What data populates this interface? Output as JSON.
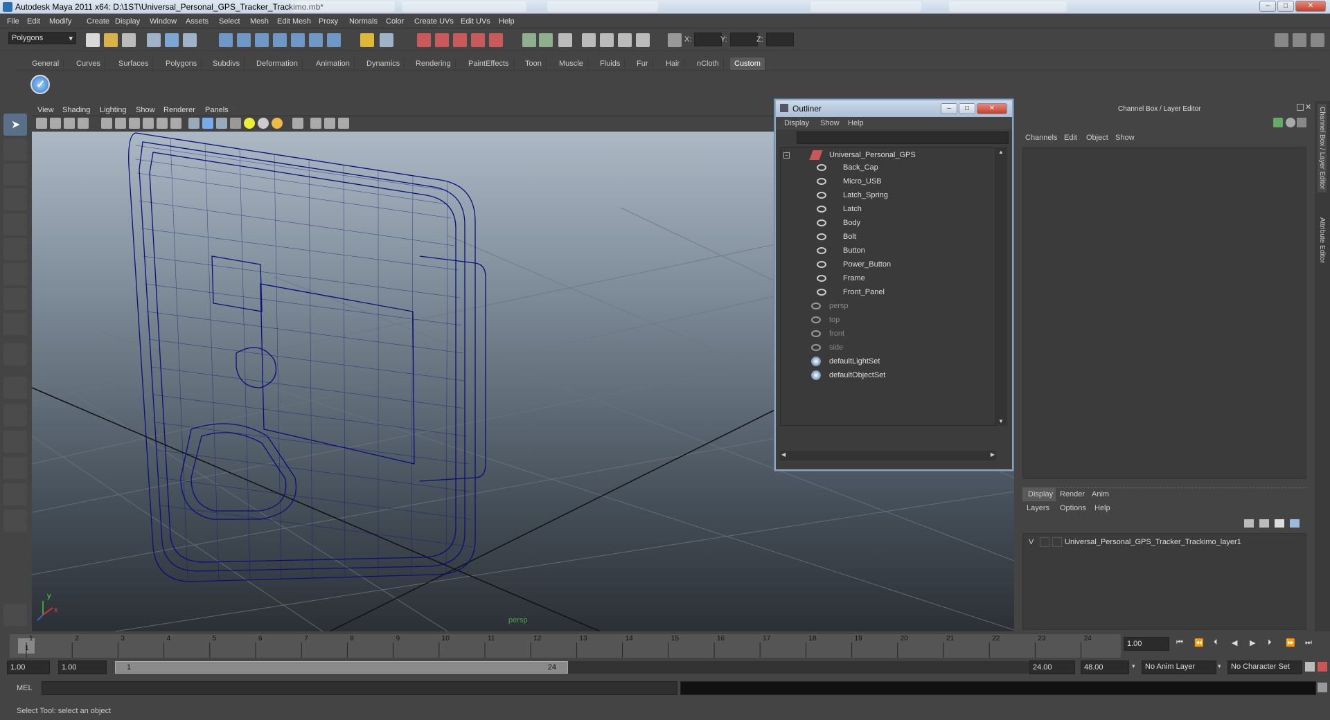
{
  "window": {
    "title": "Autodesk Maya 2011 x64: D:\\1ST\\Universal_Personal_GPS_Tracker_Trackimo.mb*"
  },
  "menus": [
    "File",
    "Edit",
    "Modify",
    "Create",
    "Display",
    "Window",
    "Assets",
    "Select",
    "Mesh",
    "Edit Mesh",
    "Proxy",
    "Normals",
    "Color",
    "Create UVs",
    "Edit UVs",
    "Help"
  ],
  "status": {
    "mode": "Polygons",
    "x_label": "X:",
    "y_label": "Y:",
    "z_label": "Z:"
  },
  "shelf_tabs": [
    "General",
    "Curves",
    "Surfaces",
    "Polygons",
    "Subdivs",
    "Deformation",
    "Animation",
    "Dynamics",
    "Rendering",
    "PaintEffects",
    "Toon",
    "Muscle",
    "Fluids",
    "Fur",
    "Hair",
    "nCloth",
    "Custom"
  ],
  "shelf_active": "Custom",
  "viewport": {
    "menus": [
      "View",
      "Shading",
      "Lighting",
      "Show",
      "Renderer",
      "Panels"
    ],
    "camera_label": "persp",
    "axis_y": "y",
    "axis_x": "x"
  },
  "outliner": {
    "title": "Outliner",
    "menus": [
      "Display",
      "Show",
      "Help"
    ],
    "root": "Universal_Personal_GPS",
    "children": [
      "Back_Cap",
      "Micro_USB",
      "Latch_Spring",
      "Latch",
      "Body",
      "Bolt",
      "Button",
      "Power_Button",
      "Frame",
      "Front_Panel"
    ],
    "cameras": [
      "persp",
      "top",
      "front",
      "side"
    ],
    "sets": [
      "defaultLightSet",
      "defaultObjectSet"
    ]
  },
  "channel_box": {
    "title": "Channel Box / Layer Editor",
    "menus": [
      "Channels",
      "Edit",
      "Object",
      "Show"
    ],
    "layer_tabs": [
      "Display",
      "Render",
      "Anim"
    ],
    "layer_menus": [
      "Layers",
      "Options",
      "Help"
    ],
    "layer_visibility": "V",
    "layer_name": "Universal_Personal_GPS_Tracker_Trackimo_layer1"
  },
  "side_tabs": [
    "Channel Box / Layer Editor",
    "Attribute Editor"
  ],
  "timeline": {
    "ticks": [
      "1",
      "2",
      "3",
      "4",
      "5",
      "6",
      "7",
      "8",
      "9",
      "10",
      "11",
      "12",
      "13",
      "14",
      "15",
      "16",
      "17",
      "18",
      "19",
      "20",
      "21",
      "22",
      "23",
      "24"
    ],
    "current_frame": "1",
    "current_field": "1.00"
  },
  "range": {
    "start": "1.00",
    "playback_start": "1.00",
    "slider_start": "1",
    "slider_end": "24",
    "playback_end": "24.00",
    "end": "48.00",
    "anim_layer": "No Anim Layer",
    "character_set": "No Character Set"
  },
  "command": {
    "label": "MEL"
  },
  "help": {
    "text": "Select Tool: select an object"
  }
}
